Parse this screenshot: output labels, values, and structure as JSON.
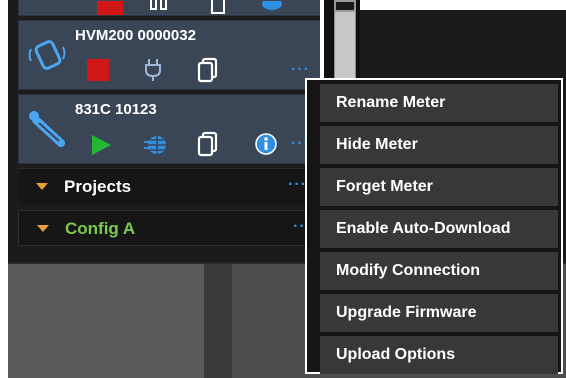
{
  "meters": [
    {
      "name": "HVM200 0000032",
      "more_label": "···"
    },
    {
      "name": "831C 10123",
      "more_label": "···"
    }
  ],
  "tree": [
    {
      "label": "Projects",
      "color": "#ffffff",
      "more_label": "···"
    },
    {
      "label": "Config A",
      "color": "#7ec850",
      "more_label": "···"
    }
  ],
  "context_menu": {
    "items": [
      "Rename Meter",
      "Hide Meter",
      "Forget Meter",
      "Enable Auto-Download",
      "Modify Connection",
      "Upgrade Firmware",
      "Upload Options"
    ]
  },
  "colors": {
    "accent_blue": "#2f8fe0",
    "stop_red": "#d01818",
    "play_green": "#22b833",
    "caret_orange": "#e8a13a"
  }
}
